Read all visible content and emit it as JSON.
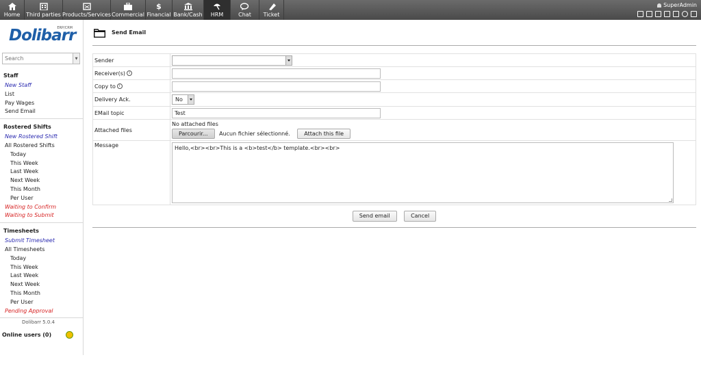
{
  "topmenu": [
    {
      "label": "Home",
      "icon": "home-icon"
    },
    {
      "label": "Third parties",
      "icon": "building-icon"
    },
    {
      "label": "Products/Services",
      "icon": "box-icon"
    },
    {
      "label": "Commercial",
      "icon": "briefcase-icon"
    },
    {
      "label": "Financial",
      "icon": "dollar-icon"
    },
    {
      "label": "Bank/Cash",
      "icon": "bank-icon"
    },
    {
      "label": "HRM",
      "icon": "umbrella-icon"
    },
    {
      "label": "Chat",
      "icon": "chat-icon"
    },
    {
      "label": "Ticket",
      "icon": "ticket-icon"
    }
  ],
  "user": {
    "name": "SuperAdmin"
  },
  "logo": {
    "brand": "Dolibarr",
    "erp": "ERP/CRM"
  },
  "search": {
    "placeholder": "Search"
  },
  "sidebar": {
    "staff": {
      "head": "Staff",
      "items": [
        "New Staff",
        "List",
        "Pay Wages",
        "Send Email"
      ]
    },
    "rostered": {
      "head": "Rostered Shifts",
      "new": "New Rostered Shift",
      "all": "All Rostered Shifts",
      "sub": [
        "Today",
        "This Week",
        "Last Week",
        "Next Week",
        "This Month",
        "Per User"
      ],
      "red": [
        "Waiting to Confirm",
        "Waiting to Submit"
      ]
    },
    "timesheets": {
      "head": "Timesheets",
      "new": "Submit Timesheet",
      "all": "All Timesheets",
      "sub": [
        "Today",
        "This Week",
        "Last Week",
        "Next Week",
        "This Month",
        "Per User"
      ],
      "red": [
        "Pending Approval"
      ]
    }
  },
  "version": "Dolibarr 5.0.4",
  "online": "Online users (0)",
  "page": {
    "title": "Send Email"
  },
  "form": {
    "sender": "Sender",
    "receivers": "Receiver(s)",
    "copyto": "Copy to",
    "delivery": "Delivery Ack.",
    "delivery_value": "No",
    "topic": "EMail topic",
    "topic_value": "Test",
    "attached": "Attached files",
    "no_files": "No attached files",
    "browse": "Parcourir...",
    "no_file_selected": "Aucun fichier sélectionné.",
    "attach": "Attach this file",
    "message": "Message",
    "message_value": "Hello,<br><br>This is a <b>test</b> template.<br><br>"
  },
  "actions": {
    "send": "Send email",
    "cancel": "Cancel"
  }
}
